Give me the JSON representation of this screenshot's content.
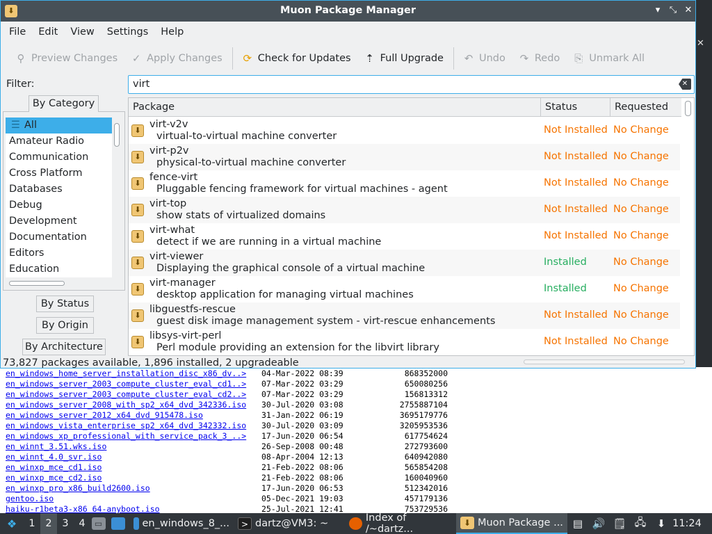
{
  "window": {
    "title": "Muon Package Manager"
  },
  "menubar": [
    "File",
    "Edit",
    "View",
    "Settings",
    "Help"
  ],
  "toolbar": {
    "preview": "Preview Changes",
    "apply": "Apply Changes",
    "check": "Check for Updates",
    "upgrade": "Full Upgrade",
    "undo": "Undo",
    "redo": "Redo",
    "unmark": "Unmark All"
  },
  "filter": {
    "label": "Filter:",
    "value": "virt"
  },
  "sidebar": {
    "tab_category": "By Category",
    "categories": [
      "All",
      "Amateur Radio",
      "Communication",
      "Cross Platform",
      "Databases",
      "Debug",
      "Development",
      "Documentation",
      "Editors",
      "Education"
    ],
    "tab_status": "By Status",
    "tab_origin": "By Origin",
    "tab_architecture": "By Architecture"
  },
  "table": {
    "headers": {
      "package": "Package",
      "status": "Status",
      "requested": "Requested"
    },
    "rows": [
      {
        "name": "virt-v2v",
        "desc": "virtual-to-virtual machine converter",
        "status": "Not Installed",
        "requested": "No Change"
      },
      {
        "name": "virt-p2v",
        "desc": "physical-to-virtual machine converter",
        "status": "Not Installed",
        "requested": "No Change"
      },
      {
        "name": "fence-virt",
        "desc": "Pluggable fencing framework for virtual machines - agent",
        "status": "Not Installed",
        "requested": "No Change"
      },
      {
        "name": "virt-top",
        "desc": "show stats of virtualized domains",
        "status": "Not Installed",
        "requested": "No Change"
      },
      {
        "name": "virt-what",
        "desc": "detect if we are running in a virtual machine",
        "status": "Not Installed",
        "requested": "No Change"
      },
      {
        "name": "virt-viewer",
        "desc": "Displaying the graphical console of a virtual machine",
        "status": "Installed",
        "requested": "No Change"
      },
      {
        "name": "virt-manager",
        "desc": "desktop application for managing virtual machines",
        "status": "Installed",
        "requested": "No Change"
      },
      {
        "name": "libguestfs-rescue",
        "desc": "guest disk image management system - virt-rescue enhancements",
        "status": "Not Installed",
        "requested": "No Change"
      },
      {
        "name": "libsys-virt-perl",
        "desc": "Perl module providing an extension for the libvirt library",
        "status": "Not Installed",
        "requested": "No Change"
      }
    ]
  },
  "statusbar": "73,827 packages available, 1,896 installed, 2 upgradeable",
  "colors": {
    "not_installed": "#f67400",
    "installed": "#27ae60",
    "accent": "#3daee9"
  },
  "background_listing": [
    {
      "name": "en_windows_home_server_installation_disc_x86_dv..>",
      "date": "04-Mar-2022 08:39",
      "size": "868352000"
    },
    {
      "name": "en_windows_server_2003_compute_cluster_eval_cd1..>",
      "date": "07-Mar-2022 03:29",
      "size": "650080256"
    },
    {
      "name": "en_windows_server_2003_compute_cluster_eval_cd2..>",
      "date": "07-Mar-2022 03:29",
      "size": "156813312"
    },
    {
      "name": "en_windows_server_2008_with_sp2_x64_dvd_342336.iso",
      "date": "30-Jul-2020 03:08",
      "size": "2755887104"
    },
    {
      "name": "en_windows_server_2012_x64_dvd_915478.iso",
      "date": "31-Jan-2022 06:19",
      "size": "3695179776"
    },
    {
      "name": "en_windows_vista_enterprise_sp2_x64_dvd_342332.iso",
      "date": "30-Jul-2020 03:09",
      "size": "3205953536"
    },
    {
      "name": "en_windows_xp_professional_with_service_pack_3_..>",
      "date": "17-Jun-2020 06:54",
      "size": "617754624"
    },
    {
      "name": "en_winnt_3.51.wks.iso",
      "date": "26-Sep-2008 00:48",
      "size": "272793600"
    },
    {
      "name": "en_winnt_4.0_svr.iso",
      "date": "08-Apr-2004 12:13",
      "size": "640942080"
    },
    {
      "name": "en_winxp_mce_cd1.iso",
      "date": "21-Feb-2022 08:06",
      "size": "565854208"
    },
    {
      "name": "en_winxp_mce_cd2.iso",
      "date": "21-Feb-2022 08:06",
      "size": "160040960"
    },
    {
      "name": "en_winxp_pro_x86_build2600.iso",
      "date": "17-Jun-2020 06:53",
      "size": "512342016"
    },
    {
      "name": "gentoo.iso",
      "date": "05-Dec-2021 19:03",
      "size": "457179136"
    },
    {
      "name": "haiku-r1beta3-x86_64-anyboot.iso",
      "date": "25-Jul-2021 12:41",
      "size": "753729536"
    }
  ],
  "taskbar": {
    "workspaces": [
      "1",
      "2",
      "3",
      "4"
    ],
    "tasks": [
      "en_windows_8_...",
      "dartz@VM3: ~",
      "Index of /~dartz...",
      "Muon Package ..."
    ],
    "clock": "11:24"
  }
}
